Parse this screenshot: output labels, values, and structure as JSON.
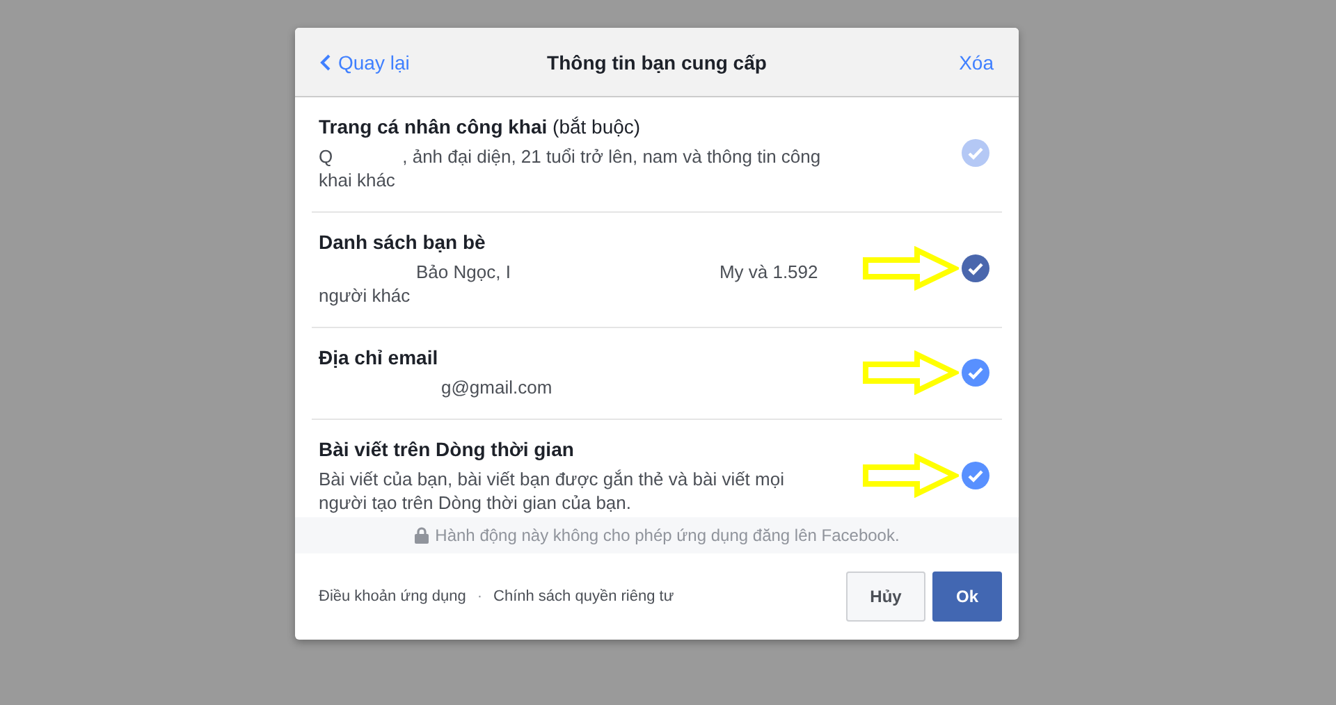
{
  "dialog": {
    "back_link": "Quay lại",
    "title": "Thông tin bạn cung cấp",
    "clear_link": "Xóa"
  },
  "items": [
    {
      "title": "**Trang cá nhân công khai** (bắt buộc)",
      "description": [
        {
          "kind": "text",
          "text": "Q"
        },
        {
          "kind": "redacted"
        },
        {
          "kind": "text",
          "text": ", ảnh đại diện, 21 tuổi trở lên, nam và thông tin công khai khác"
        }
      ],
      "checked": true,
      "disabled": true,
      "hovered": false,
      "arrow": false
    },
    {
      "title": "**Danh sách bạn bè**",
      "description": [
        {
          "kind": "redacted"
        },
        {
          "kind": "text",
          "text": "Bảo Ngọc, I"
        },
        {
          "kind": "redacted"
        },
        {
          "kind": "text",
          "text": "My và 1.592 người khác"
        }
      ],
      "checked": true,
      "disabled": false,
      "hovered": true,
      "arrow": true
    },
    {
      "title": "**Địa chỉ email**",
      "description": [
        {
          "kind": "redacted"
        },
        {
          "kind": "text",
          "text": "g@gmail.com"
        }
      ],
      "checked": true,
      "disabled": false,
      "hovered": false,
      "arrow": true
    },
    {
      "title": "**Bài viết trên Dòng thời gian**",
      "description": [
        {
          "kind": "text",
          "text": "Bài viết của bạn, bài viết bạn được gắn thẻ và bài viết mọi người tạo trên Dòng thời gian của bạn."
        }
      ],
      "checked": true,
      "disabled": false,
      "hovered": false,
      "arrow": true
    }
  ],
  "notice": "Hành động này không cho phép ứng dụng đăng lên Facebook.",
  "footer": {
    "links": [
      "Điều khoản ứng dụng",
      "Chính sách quyền riêng tư"
    ],
    "separator": "·",
    "cancel_button": "Hủy",
    "ok_button": "Ok"
  }
}
